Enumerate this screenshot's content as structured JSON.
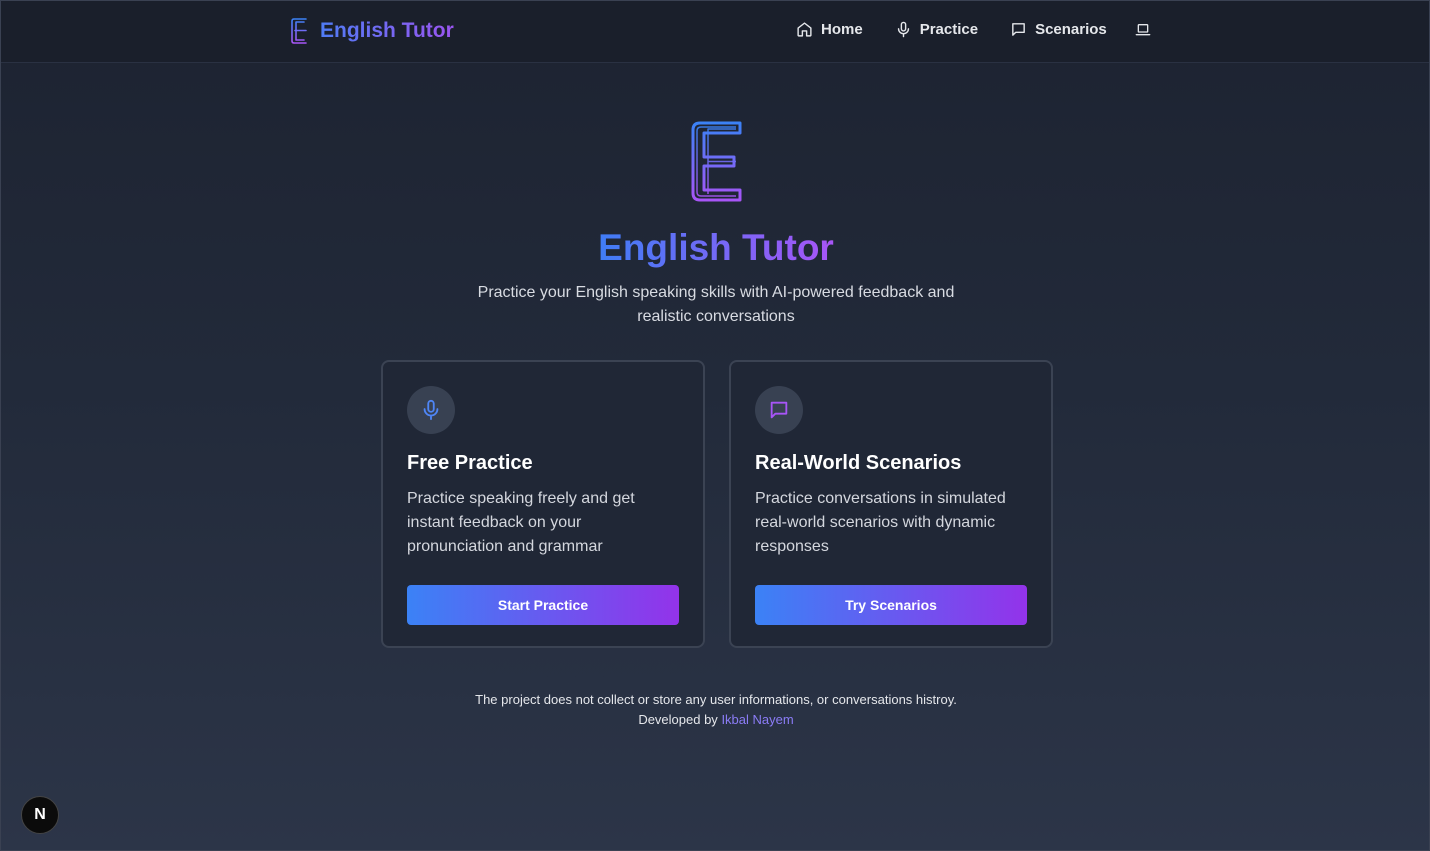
{
  "nav": {
    "brand": "English Tutor",
    "links": [
      {
        "label": "Home",
        "icon": "home-icon"
      },
      {
        "label": "Practice",
        "icon": "microphone-icon"
      },
      {
        "label": "Scenarios",
        "icon": "chat-bubble-icon"
      }
    ],
    "extra_icon": "laptop-icon"
  },
  "hero": {
    "title": "English Tutor",
    "subtitle": "Practice your English speaking skills with AI-powered feedback and realistic conversations"
  },
  "cards": [
    {
      "icon": "microphone-icon",
      "title": "Free Practice",
      "description": "Practice speaking freely and get instant feedback on your pronunciation and grammar",
      "button": "Start Practice"
    },
    {
      "icon": "chat-bubble-icon",
      "title": "Real-World Scenarios",
      "description": "Practice conversations in simulated real-world scenarios with dynamic responses",
      "button": "Try Scenarios"
    }
  ],
  "footer": {
    "notice": "The project does not collect or store any user informations, or conversations histroy.",
    "developed_by": "Developed by",
    "author": "Ikbal Nayem"
  },
  "badge": {
    "label": "N"
  },
  "colors": {
    "accent_blue": "#3b82f6",
    "accent_purple": "#9333ea",
    "background": "#1d2331",
    "link": "#8b7cf6"
  }
}
